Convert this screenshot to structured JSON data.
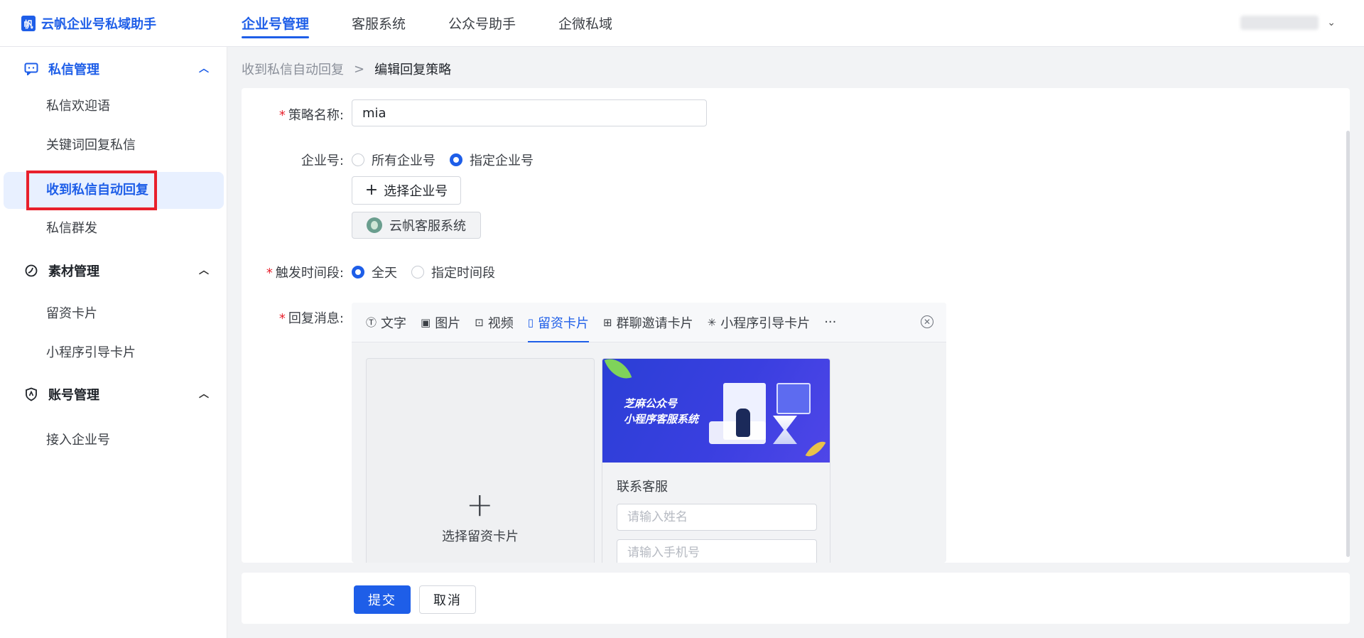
{
  "app": {
    "name": "云帆企业号私域助手"
  },
  "topnav": [
    {
      "label": "企业号管理",
      "active": true
    },
    {
      "label": "客服系统",
      "active": false
    },
    {
      "label": "公众号助手",
      "active": false
    },
    {
      "label": "企微私域",
      "active": false
    }
  ],
  "sidebar": {
    "groups": [
      {
        "label": "私信管理",
        "icon": "message-icon",
        "open": true,
        "items": [
          "私信欢迎语",
          "关键词回复私信",
          "收到私信自动回复",
          "私信群发"
        ]
      },
      {
        "label": "素材管理",
        "icon": "material-icon",
        "open": true,
        "items": [
          "留资卡片",
          "小程序引导卡片"
        ]
      },
      {
        "label": "账号管理",
        "icon": "shield-icon",
        "open": true,
        "items": [
          "接入企业号"
        ]
      }
    ],
    "active_item": "收到私信自动回复"
  },
  "breadcrumb": {
    "parent": "收到私信自动回复",
    "current": "编辑回复策略"
  },
  "form": {
    "strategy_name": {
      "label": "策略名称:",
      "value": "mia",
      "required": true
    },
    "enterprise": {
      "label": "企业号:",
      "options": [
        "所有企业号",
        "指定企业号"
      ],
      "selected": "指定企业号",
      "select_button": "选择企业号",
      "selected_chip": "云帆客服系统"
    },
    "trigger_time": {
      "label": "触发时间段:",
      "required": true,
      "options": [
        "全天",
        "指定时间段"
      ],
      "selected": "全天"
    },
    "reply": {
      "label": "回复消息:",
      "required": true,
      "tabs": [
        "文字",
        "图片",
        "视频",
        "留资卡片",
        "群聊邀请卡片",
        "小程序引导卡片"
      ],
      "active_tab": "留资卡片",
      "more": "···",
      "add_card_label": "选择留资卡片",
      "preview": {
        "banner_line1": "芝麻公众号",
        "banner_line2": "小程序客服系统",
        "title": "联系客服",
        "name_placeholder": "请输入姓名",
        "phone_placeholder": "请输入手机号"
      }
    }
  },
  "footer": {
    "submit": "提交",
    "cancel": "取消"
  },
  "colors": {
    "primary": "#1e5ee8",
    "highlight": "#e8202c"
  }
}
